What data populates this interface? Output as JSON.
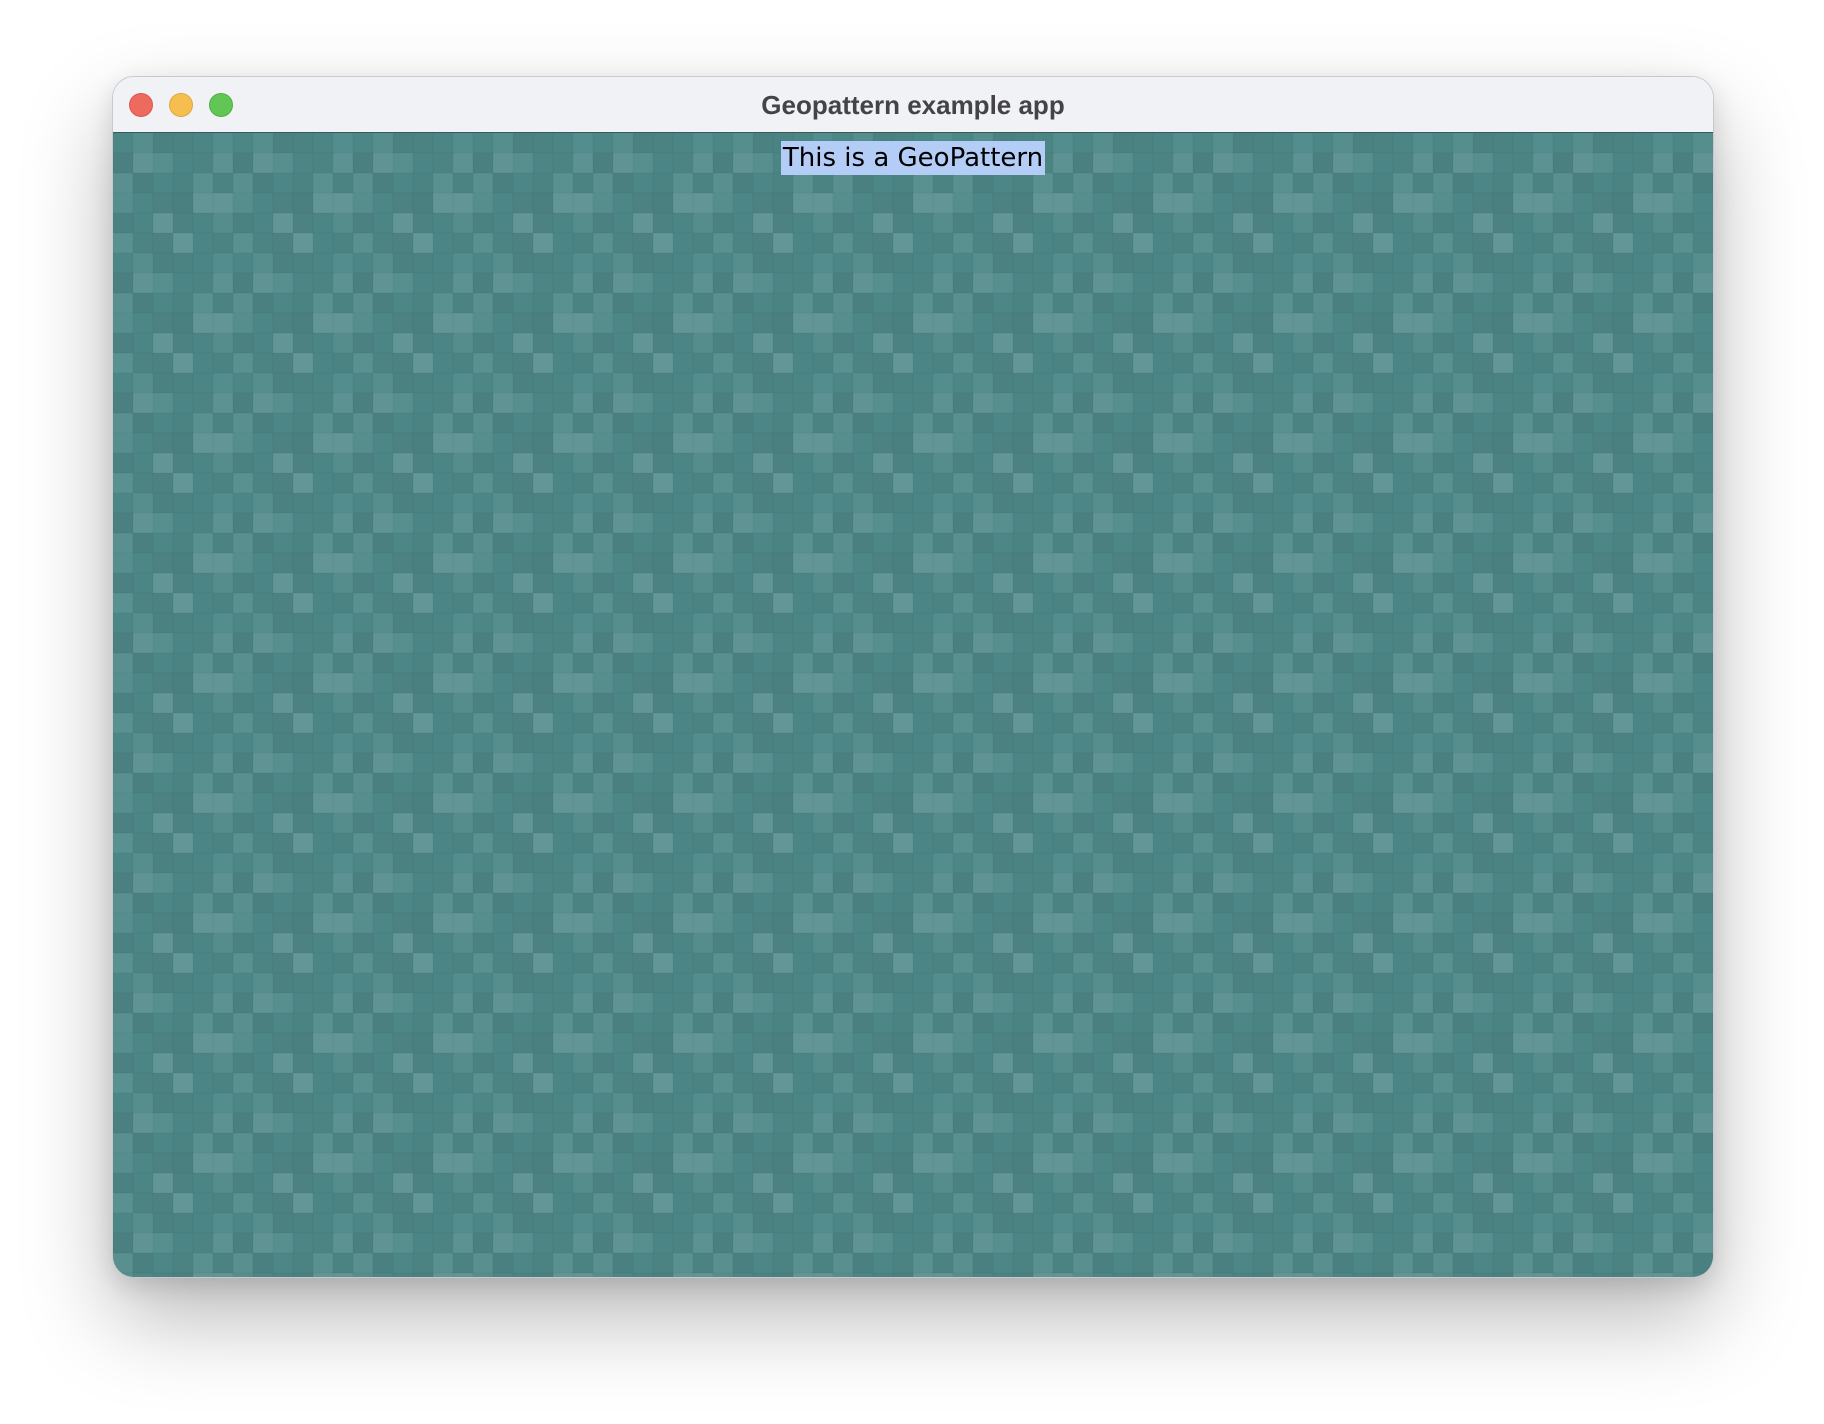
{
  "window": {
    "title": "Geopattern example app"
  },
  "content": {
    "label": "This is a GeoPattern",
    "label_highlight_color": "#b3cdf7",
    "pattern_base_color": "#4f8a8a",
    "pattern_type": "squares"
  },
  "titlebar": {
    "buttons": [
      {
        "name": "close-button",
        "color": "#ee6a5f"
      },
      {
        "name": "minimize-button",
        "color": "#f5be4f"
      },
      {
        "name": "zoom-button",
        "color": "#62c655"
      }
    ]
  }
}
